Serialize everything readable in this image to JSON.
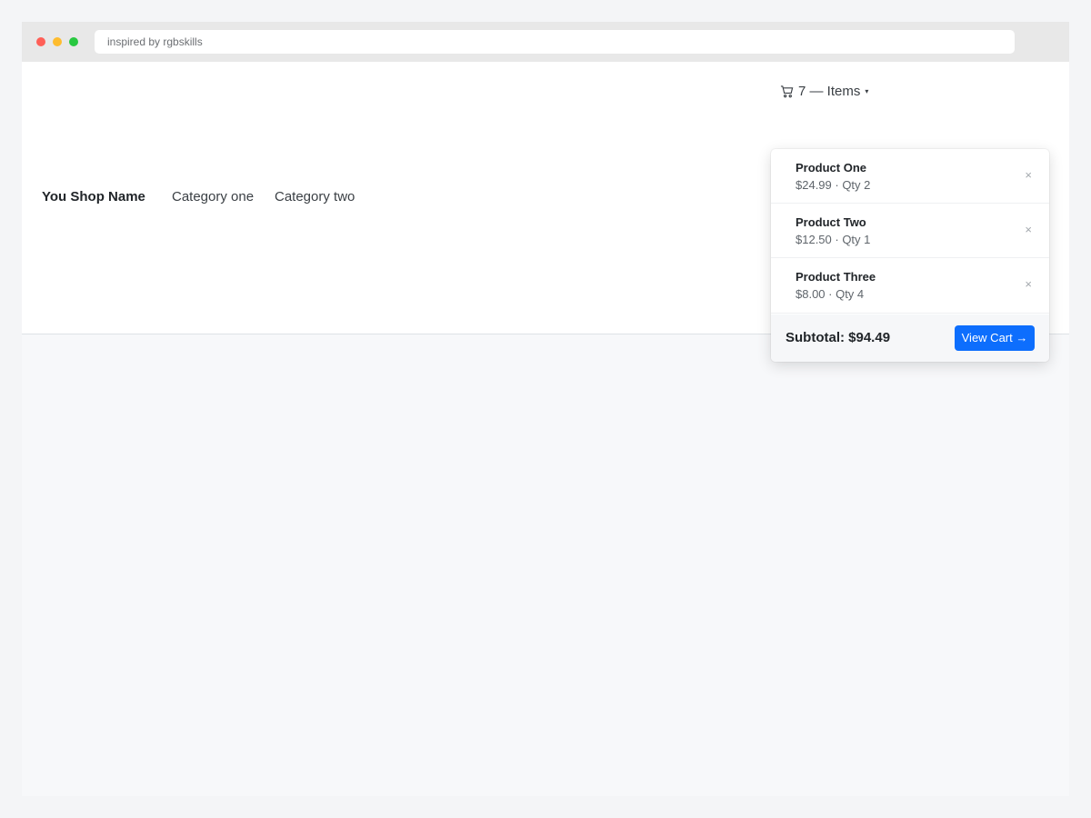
{
  "browser": {
    "address_text": "inspired by rgbskills"
  },
  "nav": {
    "brand": "You Shop Name",
    "links": [
      "Category one",
      "Category two"
    ]
  },
  "cart": {
    "icon": "cart-icon",
    "toggle_label": "7 — Items",
    "caret_glyph": "▾",
    "items": [
      {
        "name": "Product One",
        "meta": "$24.99 · Qty 2",
        "remove_glyph": "×"
      },
      {
        "name": "Product Two",
        "meta": "$12.50 · Qty 1",
        "remove_glyph": "×"
      },
      {
        "name": "Product Three",
        "meta": "$8.00 · Qty 4",
        "remove_glyph": "×"
      }
    ],
    "subtotal": "Subtotal: $94.49",
    "view_cart_label": "View Cart →"
  },
  "colors": {
    "primary": "#0d6efd",
    "traffic_red": "#ff5f57",
    "traffic_yellow": "#febc2e",
    "traffic_green": "#28c840"
  }
}
